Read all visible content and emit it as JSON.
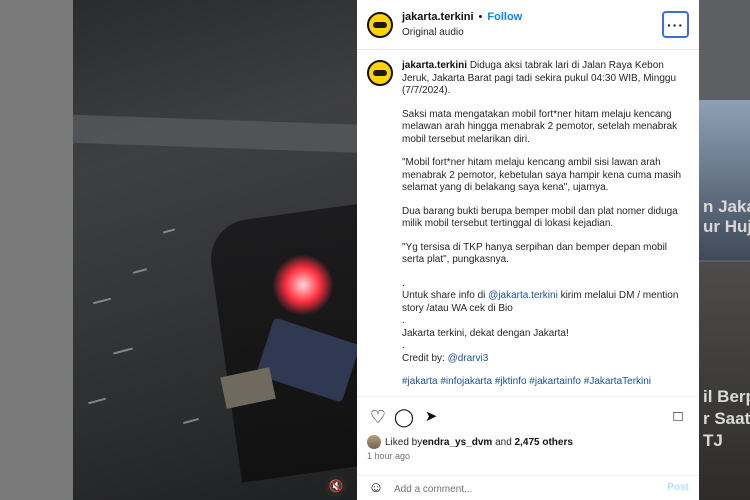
{
  "background": {
    "right_text_lines": [
      "n Jaka",
      "ur Huj",
      "il Berp",
      "r Saat",
      "TJ"
    ]
  },
  "video": {
    "mute_icon": "muted-speaker-icon"
  },
  "post": {
    "username": "jakarta.terkini",
    "separator": "•",
    "follow_label": "Follow",
    "audio_label": "Original audio",
    "more_icon": "more-options-icon",
    "caption": {
      "username": "jakarta.terkini",
      "intro": "Diduga aksi tabrak lari di Jalan Raya Kebon Jeruk, Jakarta Barat pagi tadi sekira pukul 04:30 WIB, Minggu (7/7/2024).",
      "p2": "Saksi mata mengatakan mobil fort*ner hitam melaju kencang melawan arah hingga menabrak 2 pemotor, setelah menabrak mobil tersebut melarikan diri.",
      "p3": "\"Mobil fort*ner hitam melaju kencang ambil sisi lawan arah menabrak 2 pemotor, kebetulan saya hampir kena cuma masih selamat yang di belakang saya kena\", ujarnya.",
      "p4": "Dua barang bukti berupa bemper mobil dan plat nomer diduga milik mobil tersebut tertinggal di lokasi kejadian.",
      "p5": "\"Yg tersisa di TKP hanya serpihan dan bemper depan mobil serta plat\", pungkasnya.",
      "dot1": ".",
      "share_prefix": "Untuk share info di ",
      "share_handle": "@jakarta.terkini",
      "share_suffix": " kirim melalui DM / mention story /atau WA cek di Bio",
      "dot2": ".",
      "tagline": "Jakarta terkini, dekat dengan Jakarta!",
      "dot3": ".",
      "credit_prefix": "Credit by: ",
      "credit_handle": "@drarvi3",
      "hashtags": "#jakarta #infojakarta #jktinfo #jakartainfo #JakartaTerkini"
    },
    "actions": {
      "like_icon": "heart-icon",
      "comment_icon": "comment-icon",
      "share_icon": "send-icon",
      "save_icon": "bookmark-icon"
    },
    "likes": {
      "prefix": "Liked by ",
      "user": "endra_ys_dvm",
      "and": " and ",
      "others": "2,475 others"
    },
    "time_ago": "1 hour ago",
    "comment": {
      "emoji_icon": "emoji-icon",
      "placeholder": "Add a comment...",
      "post_label": "Post"
    }
  }
}
